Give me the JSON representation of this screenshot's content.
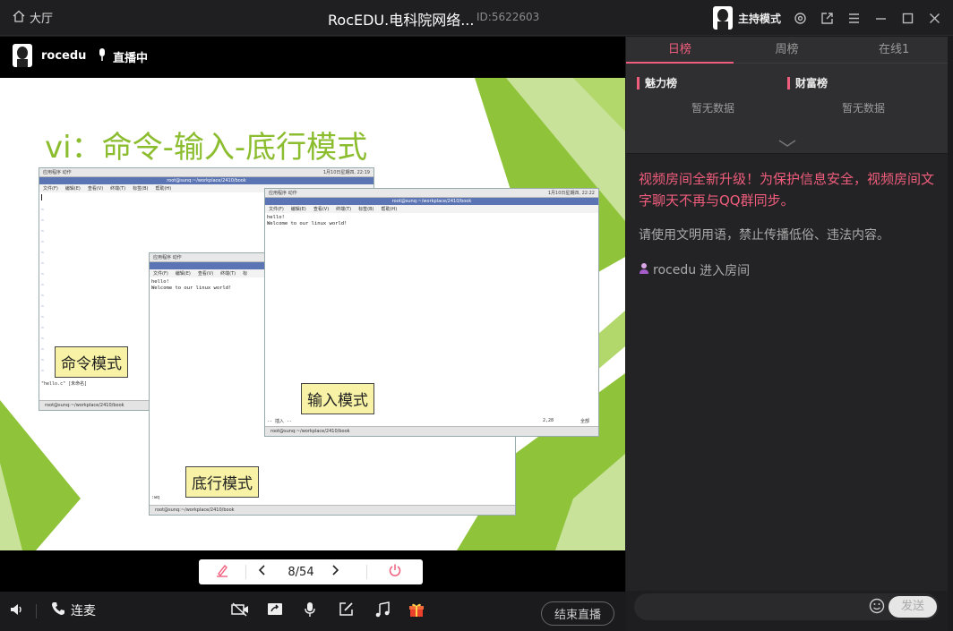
{
  "titlebar": {
    "home_label": "大厅",
    "title": "RocEDU.电科院网络...",
    "room_id": "ID:5622603",
    "host_mode_label": "主持模式"
  },
  "streambar": {
    "username": "rocedu",
    "live_label": "直播中"
  },
  "slide": {
    "title": "vi：命令-输入-底行模式",
    "term1": {
      "topbar_left": "应用程序  动作",
      "topbar_right": "1月10日星期四, 22:19",
      "title": "root@sunq:~/workplace/2410/book",
      "menu": [
        "文件(F)",
        "编辑(E)",
        "查看(V)",
        "终端(T)",
        "标签(B)",
        "帮助(H)"
      ],
      "bottom_line": "\"hello.c\" [未命名]",
      "status": "root@sunq:~/workplace/2410/book"
    },
    "term2": {
      "topbar_left": "应用程序  动作",
      "topbar_right": "1月10日星期四, 22:22",
      "title": "root@sunq:~/workplace/2410/book",
      "menu": [
        "文件(F)",
        "编辑(E)",
        "查看(V)",
        "终端(T)",
        "标签(B)",
        "帮助(H)"
      ],
      "line1": "hello!",
      "line2": "Welcome to our linux world!",
      "bottom_left": "-- 插入 --",
      "bottom_mid": "2,28",
      "bottom_right": "全部",
      "status": "root@sunq:~/workplace/2410/book"
    },
    "term3": {
      "topbar_left": "应用程序  动作",
      "menu": [
        "文件(F)",
        "编辑(E)",
        "查看(V)",
        "终端(T)",
        "标"
      ],
      "line1": "hello!",
      "line2": "Welcome to our linux world!",
      "bottom_line": ":wq",
      "status": "root@sunq:~/workplace/2410/book"
    },
    "label_command": "命令模式",
    "label_insert": "输入模式",
    "label_lastline": "底行模式"
  },
  "pager": {
    "page_text": "8/54"
  },
  "bottombar": {
    "mic_link_label": "连麦",
    "end_live_label": "结束直播"
  },
  "rank": {
    "tabs": [
      "日榜",
      "周榜",
      "在线1"
    ],
    "charm_label": "魅力榜",
    "wealth_label": "财富榜",
    "charm_empty": "暂无数据",
    "wealth_empty": "暂无数据"
  },
  "chat": {
    "notice": "视频房间全新升级！为保护信息安全，视频房间文字聊天不再与QQ群同步。",
    "rule": "请使用文明用语，禁止传播低俗、违法内容。",
    "enter_user": "rocedu",
    "enter_text": "进入房间",
    "send_label": "发送"
  },
  "colors": {
    "accent": "#f05d7c",
    "slide_green": "#8bbd2f"
  }
}
